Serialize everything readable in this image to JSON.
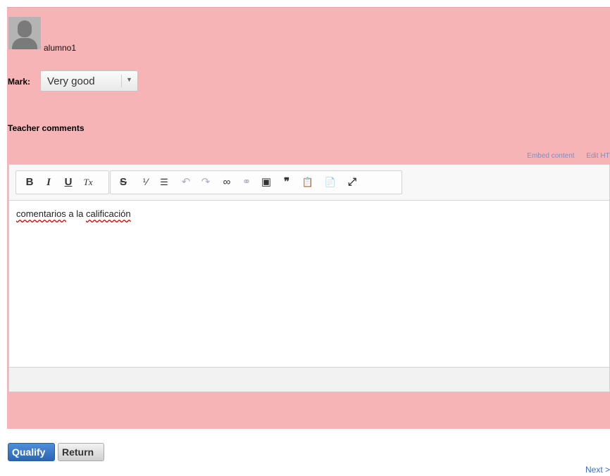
{
  "student": {
    "name": "alumno1"
  },
  "mark": {
    "label": "Mark:",
    "selected": "Very good"
  },
  "comments": {
    "heading": "Teacher comments",
    "links": [
      "Embed content",
      "Edit HTM"
    ],
    "text_word1": "comentarios",
    "text_middle": " a la ",
    "text_word2": "calificación"
  },
  "toolbar": {
    "icons": [
      "bold-icon",
      "italic-icon",
      "underline-icon",
      "remove-format-icon",
      "strikethrough-icon",
      "numbered-list-icon",
      "bulleted-list-icon",
      "undo-icon",
      "redo-icon",
      "link-icon",
      "unlink-icon",
      "image-icon",
      "blockquote-icon",
      "paste-text-icon",
      "paste-word-icon",
      "maximize-icon"
    ],
    "glyphs": {
      "bold": "B",
      "italic": "I",
      "underline": "U",
      "clear": "Tx",
      "strike": "S",
      "ol": "⅟",
      "ul": "☰",
      "undo": "↶",
      "redo": "↷",
      "link": "∞",
      "unlink": "⚭",
      "image": "▣",
      "quote": "❞",
      "paste_text": "📋",
      "paste_word": "📄",
      "maximize": "⤢"
    }
  },
  "actions": {
    "qualify": "Qualify",
    "return": "Return",
    "next": "Next >"
  },
  "colors": {
    "panel": "#f7b4b6",
    "primary_button": "#2a66b4",
    "link": "#3a6fc4"
  }
}
